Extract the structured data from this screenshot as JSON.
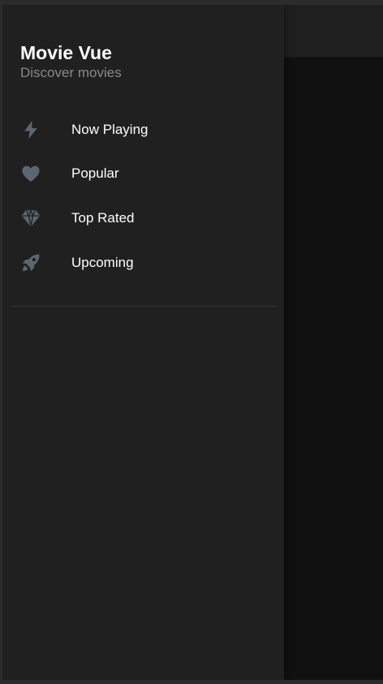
{
  "app": {
    "title": "Movie Vue",
    "subtitle": "Discover movies"
  },
  "nav": {
    "items": [
      {
        "label": "Now Playing",
        "icon": "bolt-icon"
      },
      {
        "label": "Popular",
        "icon": "heart-icon"
      },
      {
        "label": "Top Rated",
        "icon": "diamond-icon"
      },
      {
        "label": "Upcoming",
        "icon": "rocket-icon"
      }
    ]
  },
  "colors": {
    "drawer_bg": "#202020",
    "page_bg": "#101010",
    "topbar_bg": "#1f1f1f",
    "icon": "#5b6670",
    "text": "#ffffff",
    "subtext": "#8a8a8a"
  }
}
